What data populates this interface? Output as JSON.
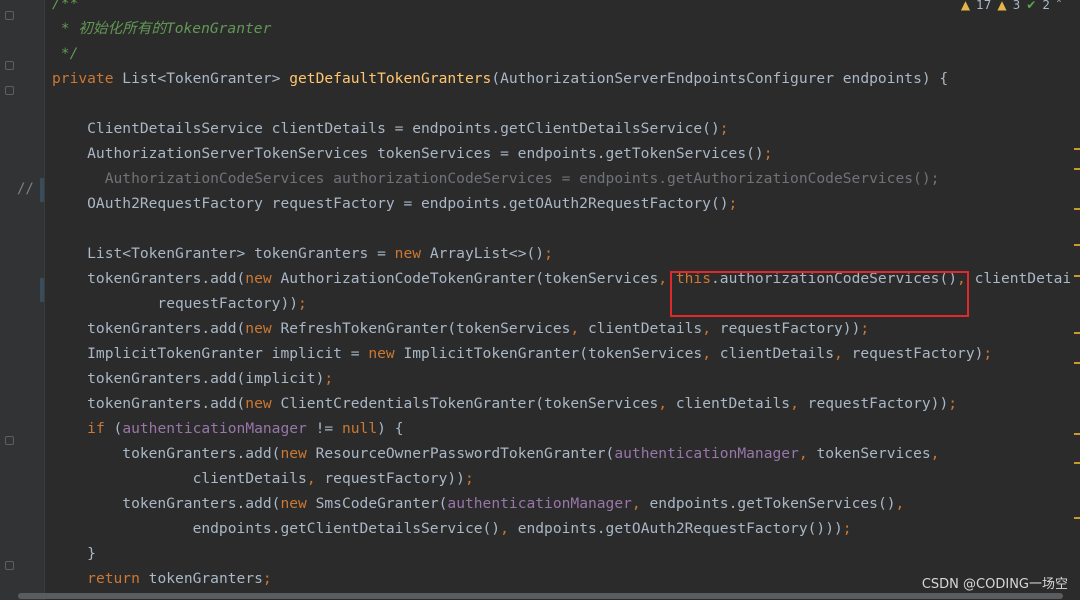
{
  "inspections": {
    "warnings": "17",
    "weak_warnings": "3",
    "ok": "2"
  },
  "gutter": {
    "comment_marker": "//"
  },
  "watermark": "CSDN @CODING一场空",
  "code_lines": [
    [
      {
        "t": "/**",
        "c": "cm"
      }
    ],
    [
      {
        "t": " * 初始化所有的TokenGranter",
        "c": "cm"
      }
    ],
    [
      {
        "t": " */",
        "c": "cm"
      }
    ],
    [
      {
        "t": "private ",
        "c": "kw"
      },
      {
        "t": "List<TokenGranter> ",
        "c": "plain"
      },
      {
        "t": "getDefaultTokenGranters",
        "c": "fn"
      },
      {
        "t": "(AuthorizationServerEndpointsConfigurer endpoints) {",
        "c": "plain"
      }
    ],
    [],
    [
      {
        "t": "    ClientDetailsService clientDetails = endpoints.getClientDetailsService()",
        "c": "plain"
      },
      {
        "t": ";",
        "c": "kw"
      }
    ],
    [
      {
        "t": "    AuthorizationServerTokenServices tokenServices = endpoints.getTokenServices()",
        "c": "plain"
      },
      {
        "t": ";",
        "c": "kw"
      }
    ],
    [
      {
        "t": "      AuthorizationCodeServices authorizationCodeServices = endpoints.getAuthorizationCodeServices();",
        "c": "dim"
      }
    ],
    [
      {
        "t": "    OAuth2RequestFactory requestFactory = endpoints.getOAuth2RequestFactory()",
        "c": "plain"
      },
      {
        "t": ";",
        "c": "kw"
      }
    ],
    [],
    [
      {
        "t": "    List<TokenGranter> tokenGranters = ",
        "c": "plain"
      },
      {
        "t": "new ",
        "c": "kw"
      },
      {
        "t": "ArrayList<>()",
        "c": "plain"
      },
      {
        "t": ";",
        "c": "kw"
      }
    ],
    [
      {
        "t": "    tokenGranters.add(",
        "c": "plain"
      },
      {
        "t": "new ",
        "c": "kw"
      },
      {
        "t": "AuthorizationCodeTokenGranter(tokenServices",
        "c": "plain"
      },
      {
        "t": ", ",
        "c": "kw"
      },
      {
        "t": "this",
        "c": "kw"
      },
      {
        "t": ".authorizationCodeServices()",
        "c": "plain"
      },
      {
        "t": ", ",
        "c": "kw"
      },
      {
        "t": "clientDetails",
        "c": "plain"
      }
    ],
    [
      {
        "t": "            requestFactory))",
        "c": "plain"
      },
      {
        "t": ";",
        "c": "kw"
      }
    ],
    [
      {
        "t": "    tokenGranters.add(",
        "c": "plain"
      },
      {
        "t": "new ",
        "c": "kw"
      },
      {
        "t": "RefreshTokenGranter(tokenServices",
        "c": "plain"
      },
      {
        "t": ", ",
        "c": "kw"
      },
      {
        "t": "clientDetails",
        "c": "plain"
      },
      {
        "t": ", ",
        "c": "kw"
      },
      {
        "t": "requestFactory))",
        "c": "plain"
      },
      {
        "t": ";",
        "c": "kw"
      }
    ],
    [
      {
        "t": "    ImplicitTokenGranter implicit = ",
        "c": "plain"
      },
      {
        "t": "new ",
        "c": "kw"
      },
      {
        "t": "ImplicitTokenGranter(tokenServices",
        "c": "plain"
      },
      {
        "t": ", ",
        "c": "kw"
      },
      {
        "t": "clientDetails",
        "c": "plain"
      },
      {
        "t": ", ",
        "c": "kw"
      },
      {
        "t": "requestFactory)",
        "c": "plain"
      },
      {
        "t": ";",
        "c": "kw"
      }
    ],
    [
      {
        "t": "    tokenGranters.add(implicit)",
        "c": "plain"
      },
      {
        "t": ";",
        "c": "kw"
      }
    ],
    [
      {
        "t": "    tokenGranters.add(",
        "c": "plain"
      },
      {
        "t": "new ",
        "c": "kw"
      },
      {
        "t": "ClientCredentialsTokenGranter(tokenServices",
        "c": "plain"
      },
      {
        "t": ", ",
        "c": "kw"
      },
      {
        "t": "clientDetails",
        "c": "plain"
      },
      {
        "t": ", ",
        "c": "kw"
      },
      {
        "t": "requestFactory))",
        "c": "plain"
      },
      {
        "t": ";",
        "c": "kw"
      }
    ],
    [
      {
        "t": "    ",
        "c": "plain"
      },
      {
        "t": "if ",
        "c": "kw"
      },
      {
        "t": "(",
        "c": "plain"
      },
      {
        "t": "authenticationManager",
        "c": "fld"
      },
      {
        "t": " != ",
        "c": "plain"
      },
      {
        "t": "null",
        "c": "kw"
      },
      {
        "t": ") {",
        "c": "plain"
      }
    ],
    [
      {
        "t": "        tokenGranters.add(",
        "c": "plain"
      },
      {
        "t": "new ",
        "c": "kw"
      },
      {
        "t": "ResourceOwnerPasswordTokenGranter(",
        "c": "plain"
      },
      {
        "t": "authenticationManager",
        "c": "fld"
      },
      {
        "t": ", ",
        "c": "kw"
      },
      {
        "t": "tokenServices",
        "c": "plain"
      },
      {
        "t": ",",
        "c": "kw"
      }
    ],
    [
      {
        "t": "                clientDetails",
        "c": "plain"
      },
      {
        "t": ", ",
        "c": "kw"
      },
      {
        "t": "requestFactory))",
        "c": "plain"
      },
      {
        "t": ";",
        "c": "kw"
      }
    ],
    [
      {
        "t": "        tokenGranters.add(",
        "c": "plain"
      },
      {
        "t": "new ",
        "c": "kw"
      },
      {
        "t": "SmsCodeGranter(",
        "c": "plain"
      },
      {
        "t": "authenticationManager",
        "c": "fld"
      },
      {
        "t": ", ",
        "c": "kw"
      },
      {
        "t": "endpoints.getTokenServices()",
        "c": "plain"
      },
      {
        "t": ",",
        "c": "kw"
      }
    ],
    [
      {
        "t": "                endpoints.getClientDetailsService()",
        "c": "plain"
      },
      {
        "t": ", ",
        "c": "kw"
      },
      {
        "t": "endpoints.getOAuth2RequestFactory()))",
        "c": "plain"
      },
      {
        "t": ";",
        "c": "kw"
      }
    ],
    [
      {
        "t": "    }",
        "c": "plain"
      }
    ],
    [
      {
        "t": "    ",
        "c": "plain"
      },
      {
        "t": "return ",
        "c": "kw"
      },
      {
        "t": "tokenGranters",
        "c": "plain"
      },
      {
        "t": ";",
        "c": "kw"
      }
    ]
  ]
}
